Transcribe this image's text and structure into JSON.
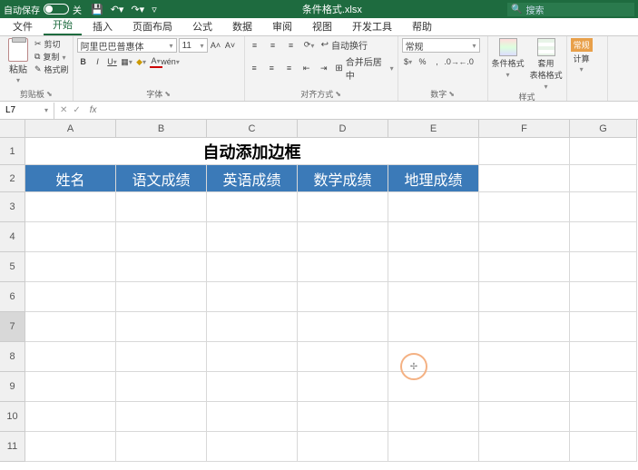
{
  "titlebar": {
    "autosave_label": "自动保存",
    "autosave_state": "关",
    "filename": "条件格式.xlsx",
    "search_placeholder": "搜索"
  },
  "tabs": {
    "file": "文件",
    "home": "开始",
    "insert": "插入",
    "layout": "页面布局",
    "formulas": "公式",
    "data": "数据",
    "review": "审阅",
    "view": "视图",
    "dev": "开发工具",
    "help": "帮助"
  },
  "ribbon": {
    "clipboard": {
      "paste": "粘贴",
      "cut": "剪切",
      "copy": "复制",
      "painter": "格式刷",
      "label": "剪贴板"
    },
    "font": {
      "name": "阿里巴巴普惠体",
      "size": "11",
      "label": "字体"
    },
    "align": {
      "wrap": "自动换行",
      "merge": "合并后居中",
      "label": "对齐方式"
    },
    "number": {
      "format": "常规",
      "label": "数字"
    },
    "styles": {
      "cond": "条件格式",
      "table": "套用\n表格格式",
      "label": "样式"
    },
    "calc": {
      "badge": "常规",
      "label": "计算"
    }
  },
  "namebox": {
    "ref": "L7"
  },
  "sheet": {
    "cols": [
      "A",
      "B",
      "C",
      "D",
      "E",
      "F",
      "G"
    ],
    "rows": [
      "1",
      "2",
      "3",
      "4",
      "5",
      "6",
      "7",
      "8",
      "9",
      "10",
      "11"
    ],
    "title": "自动添加边框",
    "headers": [
      "姓名",
      "语文成绩",
      "英语成绩",
      "数学成绩",
      "地理成绩"
    ]
  }
}
